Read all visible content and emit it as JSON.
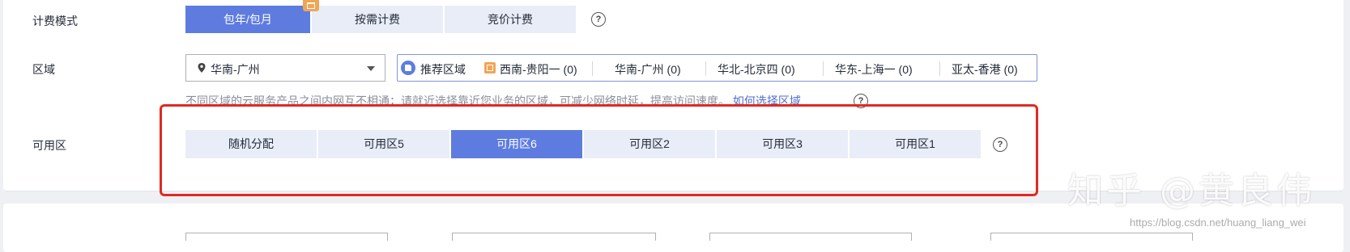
{
  "billing": {
    "label": "计费模式",
    "options": [
      "包年/包月",
      "按需计费",
      "竞价计费"
    ],
    "selected": "包年/包月"
  },
  "region": {
    "label": "区域",
    "select_value": "华南-广州",
    "recommend_title": "推荐区域",
    "recommended": [
      "西南-贵阳一 (0)",
      "华南-广州 (0)",
      "华北-北京四 (0)",
      "华东-上海一 (0)",
      "亚太-香港 (0)"
    ],
    "tip": "不同区域的云服务产品之间内网互不相通；请就近选择靠近您业务的区域，可减少网络时延，提高访问速度。",
    "tip_link": "如何选择区域"
  },
  "az": {
    "label": "可用区",
    "options": [
      "随机分配",
      "可用区5",
      "可用区6",
      "可用区2",
      "可用区3",
      "可用区1"
    ],
    "selected": "可用区6"
  },
  "watermark": "知乎 @黄良伟",
  "csdn_watermark": "https://blog.csdn.net/huang_liang_wei",
  "colors": {
    "accent": "#5e7ce0",
    "option_bg": "#e8edf7",
    "highlight_box": "#e02a24"
  }
}
